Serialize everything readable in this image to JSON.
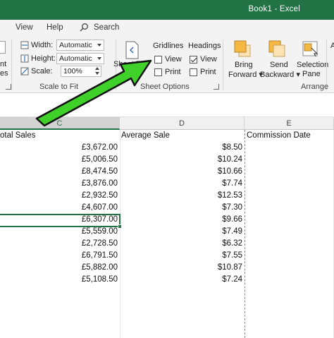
{
  "window": {
    "title": "Book1  -  Excel"
  },
  "tabs": [
    {
      "label": "View"
    },
    {
      "label": "Help"
    },
    {
      "label": "Search"
    }
  ],
  "ribbon": {
    "left_partial": {
      "line1": "nt",
      "line2": "es"
    },
    "scale_to_fit": {
      "width_label": "Width:",
      "width_value": "Automatic",
      "height_label": "Height:",
      "height_value": "Automatic",
      "scale_label": "Scale:",
      "scale_value": "100%",
      "group_label": "Scale to Fit"
    },
    "sheet_options": {
      "sheet_btn_partial": "Sheet R",
      "gridlines_title": "Gridlines",
      "gridlines_view_label": "View",
      "gridlines_view_checked": false,
      "gridlines_print_label": "Print",
      "gridlines_print_checked": false,
      "headings_title": "Headings",
      "headings_view_label": "View",
      "headings_view_checked": true,
      "headings_print_label": "Print",
      "headings_print_checked": false,
      "group_label": "Sheet Options"
    },
    "arrange": {
      "bring_forward_line1": "Bring",
      "bring_forward_line2": "Forward ▾",
      "send_backward_line1": "Send",
      "send_backward_line2": "Backward ▾",
      "selection_pane_line1": "Selection",
      "selection_pane_line2": "Pane",
      "group_label": "Arrange",
      "partial_right": "A"
    }
  },
  "grid": {
    "columns": [
      {
        "label": "C",
        "active": true
      },
      {
        "label": "D",
        "active": false
      },
      {
        "label": "E",
        "active": false
      }
    ],
    "header_row": {
      "c": "otal Sales",
      "d": "Average Sale",
      "e": "Commission Date"
    },
    "rows": [
      {
        "c": "£3,672.00",
        "d": "$8.50"
      },
      {
        "c": "£5,006.50",
        "d": "$10.24"
      },
      {
        "c": "£8,474.50",
        "d": "$10.66"
      },
      {
        "c": "£3,876.00",
        "d": "$7.74"
      },
      {
        "c": "£2,932.50",
        "d": "$12.53"
      },
      {
        "c": "£4,607.00",
        "d": "$7.30"
      },
      {
        "c": "£6,307.00",
        "d": "$9.66"
      },
      {
        "c": "£5,559.00",
        "d": "$7.49"
      },
      {
        "c": "£2,728.50",
        "d": "$6.32"
      },
      {
        "c": "£6,791.50",
        "d": "$7.55"
      },
      {
        "c": "£5,882.00",
        "d": "$10.87"
      },
      {
        "c": "£5,108.50",
        "d": "$7.24"
      }
    ]
  },
  "colors": {
    "excel_green": "#217346",
    "arrow_fill": "#3fd12a",
    "arrow_outline": "#111111"
  }
}
